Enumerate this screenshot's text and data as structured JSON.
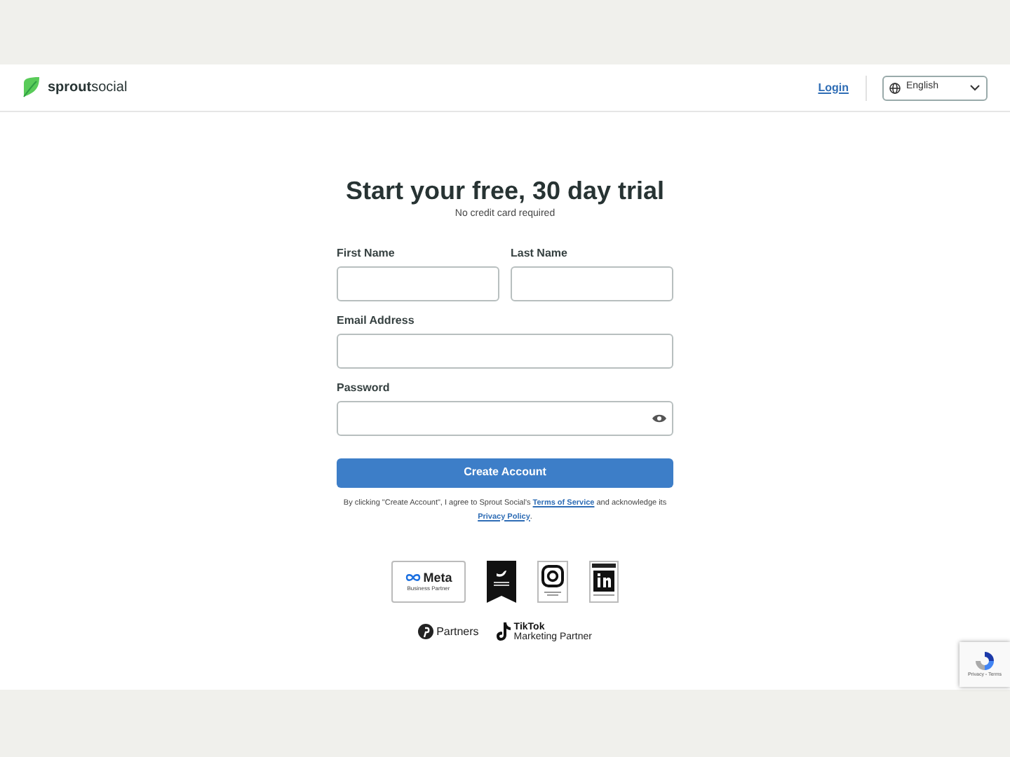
{
  "header": {
    "logo_bold": "sprout",
    "logo_light": "social",
    "login": "Login",
    "language": "English"
  },
  "form": {
    "title": "Start your free, 30 day trial",
    "subtitle": "No credit card required",
    "fields": [
      {
        "label": "First Name",
        "kind": "half"
      },
      {
        "label": "Last Name",
        "kind": "half"
      },
      {
        "label": "Email Address",
        "kind": "full"
      },
      {
        "label": "Password",
        "kind": "password"
      }
    ],
    "submit": "Create Account",
    "legal": {
      "before": "By clicking \"Create Account\", I agree to Sprout Social's",
      "terms": "Terms of Service",
      "middle": "and acknowledge its",
      "privacy": "Privacy Policy",
      "after": "."
    }
  },
  "partners": {
    "meta_name": "Meta",
    "meta_sub": "Business Partner",
    "pinterest": "Partners",
    "tiktok_name": "TikTok",
    "tiktok_sub": "Marketing Partner"
  },
  "recaptcha": {
    "links": "Privacy - Terms"
  }
}
